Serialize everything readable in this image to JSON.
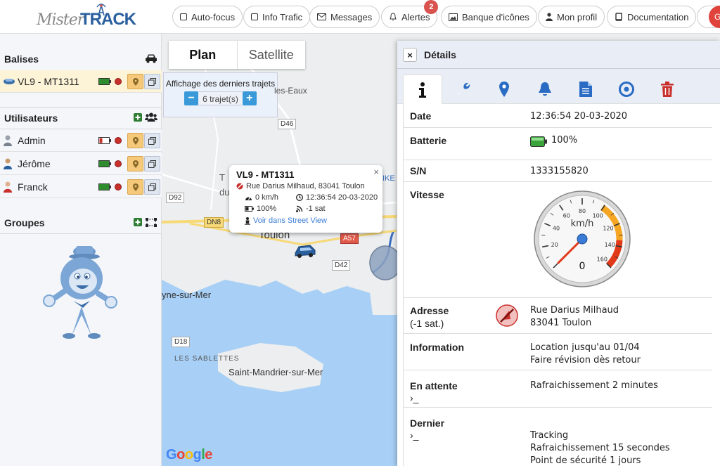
{
  "logo": {
    "part1": "Mister",
    "part2": "TRACK"
  },
  "topbar": {
    "buttons": [
      {
        "label": "Auto-focus",
        "icon": "square-icon"
      },
      {
        "label": "Info Trafic",
        "icon": "square-icon"
      },
      {
        "label": "Messages",
        "icon": "envelope-icon"
      },
      {
        "label": "Alertes",
        "icon": "bell-icon",
        "badge": "2"
      },
      {
        "label": "Banque d'icônes",
        "icon": "image-icon"
      },
      {
        "label": "Mon profil",
        "icon": "user-icon"
      },
      {
        "label": "Documentation",
        "icon": "book-icon"
      }
    ],
    "edge_label": "G"
  },
  "sidebar": {
    "balises_title": "Balises",
    "balises": [
      {
        "label": "VL9 - MT1311",
        "selected": true
      }
    ],
    "users_title": "Utilisateurs",
    "users": [
      {
        "label": "Admin",
        "battery": "low"
      },
      {
        "label": "Jérôme",
        "battery": "full"
      },
      {
        "label": "Franck",
        "battery": "full"
      }
    ],
    "groups_title": "Groupes"
  },
  "map": {
    "tabs": [
      "Plan",
      "Satellite"
    ],
    "trajets_title": "Affichage des derniers trajets",
    "trajets_value": "6 trajet(s)",
    "minus": "−",
    "plus": "+",
    "labels": {
      "eaux": "les-Eaux",
      "toulon": "Toulon",
      "seyne": "yne-sur-Mer",
      "sablettes": "LES SABLETTES",
      "mandrier": "Saint-Mandrier-sur-Mer",
      "t": "T",
      "du": "du",
      "ike": "IKE"
    },
    "roads": {
      "d46": "D46",
      "d92": "D92",
      "dn8": "DN8",
      "d42": "D42",
      "d18": "D18",
      "a57": "A57"
    },
    "popup": {
      "title": "VL9 - MT1311",
      "close": "×",
      "address": "Rue Darius Milhaud, 83041 Toulon",
      "speed": "0 km/h",
      "time": "12:36:54 20-03-2020",
      "battery": "100%",
      "sat": "-1 sat",
      "link": "Voir dans Street View"
    },
    "google": [
      "G",
      "o",
      "o",
      "g",
      "l",
      "e"
    ],
    "google_colors": [
      "#4285F4",
      "#EA4335",
      "#FBBC05",
      "#4285F4",
      "#34A853",
      "#EA4335"
    ]
  },
  "details": {
    "title": "Détails",
    "close": "×",
    "tabs": [
      "info-icon",
      "wrench-icon",
      "map-marker-icon",
      "bell-icon",
      "document-icon",
      "target-icon",
      "trash-icon"
    ],
    "rows": {
      "date": {
        "k": "Date",
        "v": "12:36:54 20-03-2020"
      },
      "batterie": {
        "k": "Batterie",
        "v": "100%"
      },
      "sn": {
        "k": "S/N",
        "v": "1333155820"
      },
      "vitesse": {
        "k": "Vitesse"
      },
      "adresse": {
        "k": "Adresse",
        "k2": "(-1 sat.)",
        "v1": "Rue Darius Milhaud",
        "v2": "83041 Toulon"
      },
      "information": {
        "k": "Information",
        "v1": "Location jusqu'au 01/04",
        "v2": "Faire révision dès retour"
      },
      "attente": {
        "k": "En attente",
        "k2": "›_",
        "v": "Rafraichissement 2 minutes"
      },
      "dernier": {
        "k": "Dernier",
        "k2": "›_",
        "v1": "Tracking",
        "v2": "Rafraichissement 15 secondes",
        "v3": "Point de sécurité 1 jours"
      }
    },
    "gauge": {
      "unit": "km/h",
      "value": 0,
      "display": "0",
      "max": 160,
      "ticks": [
        "0",
        "20",
        "40",
        "60",
        "80",
        "100",
        "120",
        "140",
        "160"
      ]
    }
  },
  "colors": {
    "accent": "#2a5f9e",
    "tab_icon": "#2a6cc4",
    "trash": "#c9302c",
    "water": "#a8cff5",
    "land": "#eceeef"
  }
}
